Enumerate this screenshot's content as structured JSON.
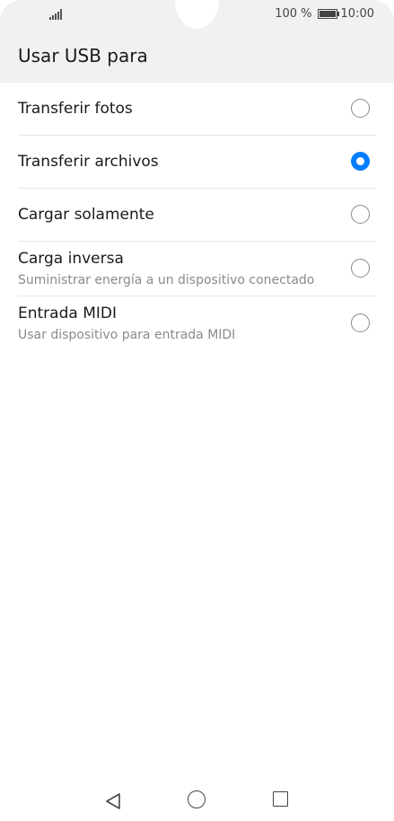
{
  "status_bar": {
    "battery_percent": "100 %",
    "time": "10:00",
    "signal_icon": "signal-icon",
    "battery_icon": "battery-icon"
  },
  "header": {
    "title": "Usar USB para"
  },
  "options": [
    {
      "label": "Transferir fotos",
      "sublabel": "",
      "selected": false
    },
    {
      "label": "Transferir archivos",
      "sublabel": "",
      "selected": true
    },
    {
      "label": "Cargar solamente",
      "sublabel": "",
      "selected": false
    },
    {
      "label": "Carga inversa",
      "sublabel": "Suministrar energía a un dispositivo conectado",
      "selected": false
    },
    {
      "label": "Entrada MIDI",
      "sublabel": "Usar dispositivo para entrada MIDI",
      "selected": false
    }
  ],
  "colors": {
    "accent": "#007dff",
    "header_bg": "#f1f1f1"
  },
  "nav_bar": {
    "back_icon": "back-icon",
    "home_icon": "home-icon",
    "recent_icon": "recent-apps-icon"
  }
}
